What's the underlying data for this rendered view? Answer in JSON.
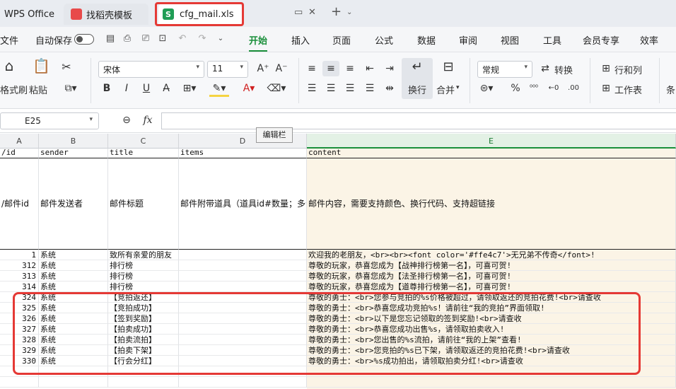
{
  "tabs": {
    "home": "WPS Office",
    "templates": "找稻壳模板",
    "file": "cfg_mail.xls",
    "file_icon_letter": "S"
  },
  "menu": {
    "file": "文件",
    "autosave": "自动保存",
    "items": [
      "开始",
      "插入",
      "页面",
      "公式",
      "数据",
      "审阅",
      "视图",
      "工具",
      "会员专享",
      "效率"
    ],
    "active": "开始"
  },
  "ribbon": {
    "format_painter": "格式刷",
    "paste": "粘贴",
    "font_name": "宋体",
    "font_size": "11",
    "wrap": "换行",
    "merge": "合并",
    "number_format": "常规",
    "convert": "转换",
    "row_col": "行和列",
    "worksheet": "工作表",
    "cut_label": "条"
  },
  "formula_bar": {
    "cell_ref": "E25",
    "fx": "fx",
    "tooltip": "编辑栏"
  },
  "columns": [
    "A",
    "B",
    "C",
    "D",
    "E"
  ],
  "selected_column": "E",
  "header_row": {
    "a": "/id",
    "b": "sender",
    "c": "title",
    "d": "items",
    "e": "content"
  },
  "desc_row": {
    "a": "/邮件id",
    "b": "邮件发送者",
    "c": "邮件标题",
    "d": "邮件附带道具（道具id#数量；多个",
    "e": "邮件内容，需要支持颜色、换行代码、支持超链接"
  },
  "rows": [
    {
      "id": "1",
      "sender": "系统",
      "title": "致所有亲爱的朋友",
      "content": "欢迎我的老朋友，<br><br><font color='#ffe4c7'>无兄弟不传奇</font>!"
    },
    {
      "id": "312",
      "sender": "系统",
      "title": "排行榜",
      "content": "尊敬的玩家，恭喜您成为【战神排行榜第一名】，可喜可贺!"
    },
    {
      "id": "313",
      "sender": "系统",
      "title": "排行榜",
      "content": "尊敬的玩家，恭喜您成为【法圣排行榜第一名】，可喜可贺!"
    },
    {
      "id": "314",
      "sender": "系统",
      "title": "排行榜",
      "content": "尊敬的玩家，恭喜您成为【道尊排行榜第一名】，可喜可贺!"
    },
    {
      "id": "324",
      "sender": "系统",
      "title": "【竞拍返还】",
      "content": "尊敬的勇士：<br>您参与竞拍的%s价格被超过，请领取返还的竞拍花费!<br>请查收"
    },
    {
      "id": "325",
      "sender": "系统",
      "title": "【竞拍成功】",
      "content": "尊敬的勇士：<br>恭喜您成功竞拍%s！请前往“我的竞拍”界面领取!"
    },
    {
      "id": "326",
      "sender": "系统",
      "title": "【签到奖励】",
      "content": "尊敬的勇士：<br>以下是您忘记领取的签到奖励!<br>请查收"
    },
    {
      "id": "327",
      "sender": "系统",
      "title": "【拍卖成功】",
      "content": "尊敬的勇士：<br>恭喜您成功出售%s，请领取拍卖收入!"
    },
    {
      "id": "328",
      "sender": "系统",
      "title": "【拍卖流拍】",
      "content": "尊敬的勇士：<br>您出售的%s流拍，请前往“我的上架”查看!"
    },
    {
      "id": "329",
      "sender": "系统",
      "title": "【拍卖下架】",
      "content": "尊敬的勇士：<br>您竞拍的%s已下架，请领取返还的竞拍花费!<br>请查收"
    },
    {
      "id": "330",
      "sender": "系统",
      "title": "【行会分红】",
      "content": "尊敬的勇士：<br>%s成功拍出，请领取拍卖分红!<br>请查收"
    }
  ]
}
